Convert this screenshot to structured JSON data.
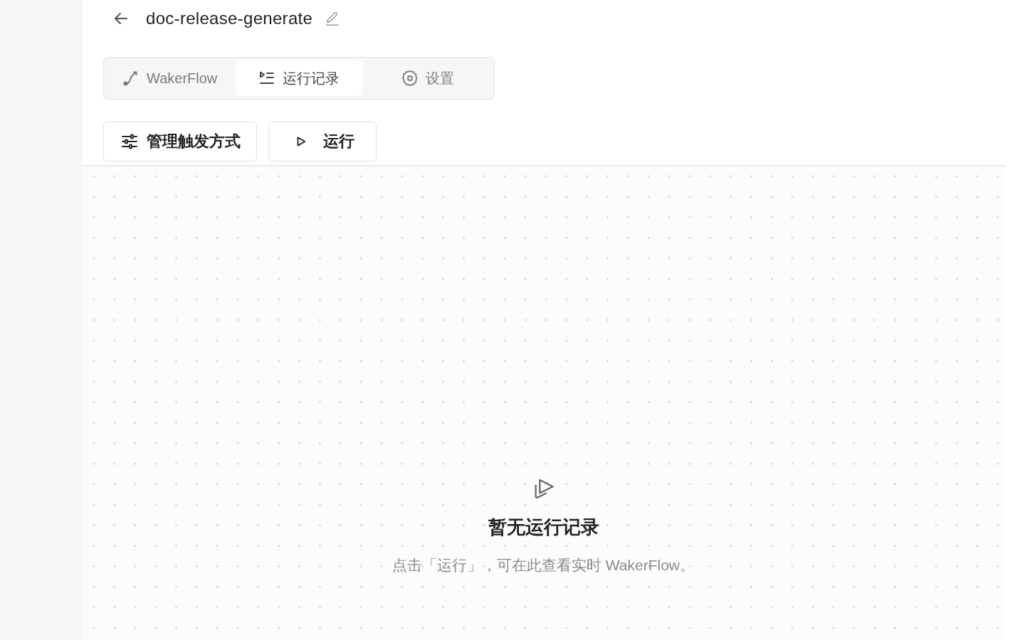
{
  "header": {
    "title": "doc-release-generate"
  },
  "tabs": [
    {
      "label": "WakerFlow",
      "selected": false
    },
    {
      "label": "运行记录",
      "selected": true
    },
    {
      "label": "设置",
      "selected": false
    }
  ],
  "actions": [
    {
      "label": "管理触发方式"
    },
    {
      "label": "运行"
    }
  ],
  "empty_state": {
    "title": "暂无运行记录",
    "message": "点击「运行」，可在此查看实时 WakerFlow。"
  }
}
